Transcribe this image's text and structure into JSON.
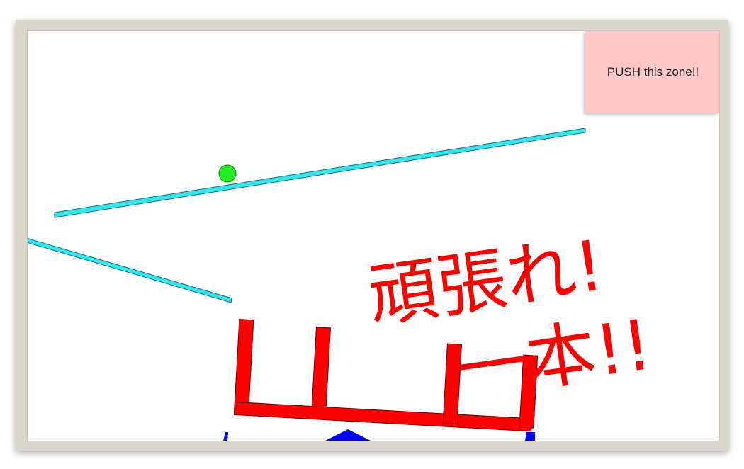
{
  "push_zone": {
    "label": "PUSH this zone!!",
    "color": "#ffc9c9"
  },
  "cheer_text": {
    "line1": "頑張れ!",
    "line2": "一本!!",
    "color": "#ff0000"
  },
  "colors": {
    "rail": "#33e6ee",
    "ball": "#22ee22",
    "cup": "#ff0000",
    "base": "#0000ff",
    "frame": "#d9d6cc"
  }
}
